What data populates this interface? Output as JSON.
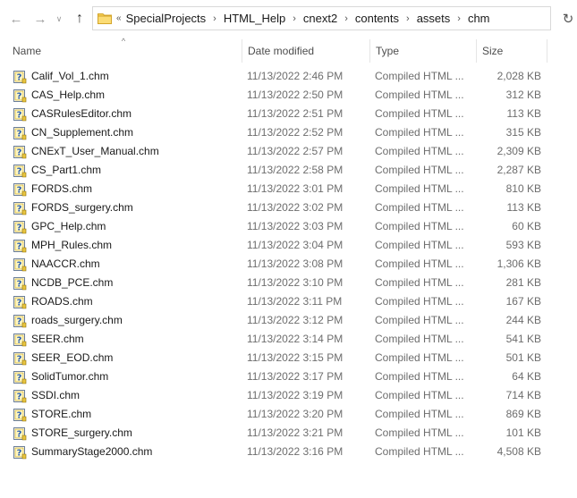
{
  "nav": {
    "back_icon": "back-arrow-icon",
    "forward_icon": "forward-arrow-icon",
    "recent_icon": "chevron-down-icon",
    "up_icon": "up-arrow-icon",
    "refresh_icon": "refresh-icon"
  },
  "address": {
    "overflow": "«",
    "crumbs": [
      "SpecialProjects",
      "HTML_Help",
      "cnext2",
      "contents",
      "assets",
      "chm"
    ],
    "separator": "›"
  },
  "columns": {
    "name": "Name",
    "date": "Date modified",
    "type": "Type",
    "size": "Size",
    "sort_indicator": "^"
  },
  "files": [
    {
      "name": "Calif_Vol_1.chm",
      "date": "11/13/2022 2:46 PM",
      "type": "Compiled HTML ...",
      "size": "2,028 KB"
    },
    {
      "name": "CAS_Help.chm",
      "date": "11/13/2022 2:50 PM",
      "type": "Compiled HTML ...",
      "size": "312 KB"
    },
    {
      "name": "CASRulesEditor.chm",
      "date": "11/13/2022 2:51 PM",
      "type": "Compiled HTML ...",
      "size": "113 KB"
    },
    {
      "name": "CN_Supplement.chm",
      "date": "11/13/2022 2:52 PM",
      "type": "Compiled HTML ...",
      "size": "315 KB"
    },
    {
      "name": "CNExT_User_Manual.chm",
      "date": "11/13/2022 2:57 PM",
      "type": "Compiled HTML ...",
      "size": "2,309 KB"
    },
    {
      "name": "CS_Part1.chm",
      "date": "11/13/2022 2:58 PM",
      "type": "Compiled HTML ...",
      "size": "2,287 KB"
    },
    {
      "name": "FORDS.chm",
      "date": "11/13/2022 3:01 PM",
      "type": "Compiled HTML ...",
      "size": "810 KB"
    },
    {
      "name": "FORDS_surgery.chm",
      "date": "11/13/2022 3:02 PM",
      "type": "Compiled HTML ...",
      "size": "113 KB"
    },
    {
      "name": "GPC_Help.chm",
      "date": "11/13/2022 3:03 PM",
      "type": "Compiled HTML ...",
      "size": "60 KB"
    },
    {
      "name": "MPH_Rules.chm",
      "date": "11/13/2022 3:04 PM",
      "type": "Compiled HTML ...",
      "size": "593 KB"
    },
    {
      "name": "NAACCR.chm",
      "date": "11/13/2022 3:08 PM",
      "type": "Compiled HTML ...",
      "size": "1,306 KB"
    },
    {
      "name": "NCDB_PCE.chm",
      "date": "11/13/2022 3:10 PM",
      "type": "Compiled HTML ...",
      "size": "281 KB"
    },
    {
      "name": "ROADS.chm",
      "date": "11/13/2022 3:11 PM",
      "type": "Compiled HTML ...",
      "size": "167 KB"
    },
    {
      "name": "roads_surgery.chm",
      "date": "11/13/2022 3:12 PM",
      "type": "Compiled HTML ...",
      "size": "244 KB"
    },
    {
      "name": "SEER.chm",
      "date": "11/13/2022 3:14 PM",
      "type": "Compiled HTML ...",
      "size": "541 KB"
    },
    {
      "name": "SEER_EOD.chm",
      "date": "11/13/2022 3:15 PM",
      "type": "Compiled HTML ...",
      "size": "501 KB"
    },
    {
      "name": "SolidTumor.chm",
      "date": "11/13/2022 3:17 PM",
      "type": "Compiled HTML ...",
      "size": "64 KB"
    },
    {
      "name": "SSDI.chm",
      "date": "11/13/2022 3:19 PM",
      "type": "Compiled HTML ...",
      "size": "714 KB"
    },
    {
      "name": "STORE.chm",
      "date": "11/13/2022 3:20 PM",
      "type": "Compiled HTML ...",
      "size": "869 KB"
    },
    {
      "name": "STORE_surgery.chm",
      "date": "11/13/2022 3:21 PM",
      "type": "Compiled HTML ...",
      "size": "101 KB"
    },
    {
      "name": "SummaryStage2000.chm",
      "date": "11/13/2022 3:16 PM",
      "type": "Compiled HTML ...",
      "size": "4,508 KB"
    }
  ],
  "colors": {
    "folder": "#e8b93a",
    "icon_frame": "#3c6fb0",
    "icon_help": "#c8a000"
  }
}
